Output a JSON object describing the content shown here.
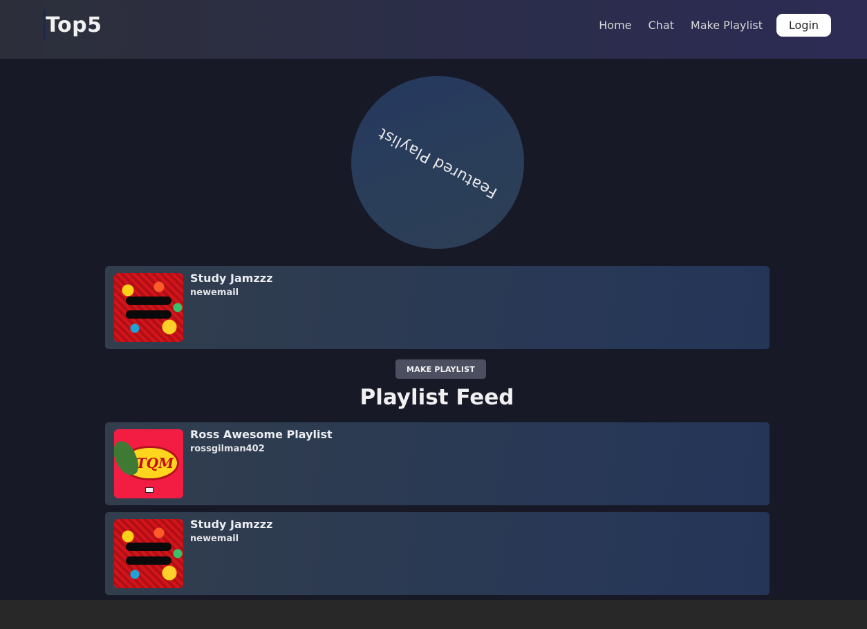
{
  "brand": {
    "name": "Top5"
  },
  "nav": {
    "links": [
      "Home",
      "Chat",
      "Make Playlist"
    ],
    "login_label": "Login"
  },
  "featured": {
    "label": "Featured Playlist",
    "card": {
      "title": "Study Jamzzz",
      "author": "newemail",
      "cover_icon": "equals-album-cover"
    }
  },
  "make_playlist_label": "MAKE PLAYLIST",
  "feed": {
    "heading": "Playlist Feed",
    "items": [
      {
        "title": "Ross Awesome Playlist",
        "author": "rossgilman402",
        "cover_icon": "tqm-album-cover"
      },
      {
        "title": "Study Jamzzz",
        "author": "newemail",
        "cover_icon": "equals-album-cover"
      }
    ]
  },
  "colors": {
    "navbar_start": "#2c2f3a",
    "navbar_end": "#2d2c55",
    "page_bg": "#171926",
    "card_bg": "#283856",
    "button_bg": "#4c4f5f",
    "login_bg": "#ffffff"
  }
}
